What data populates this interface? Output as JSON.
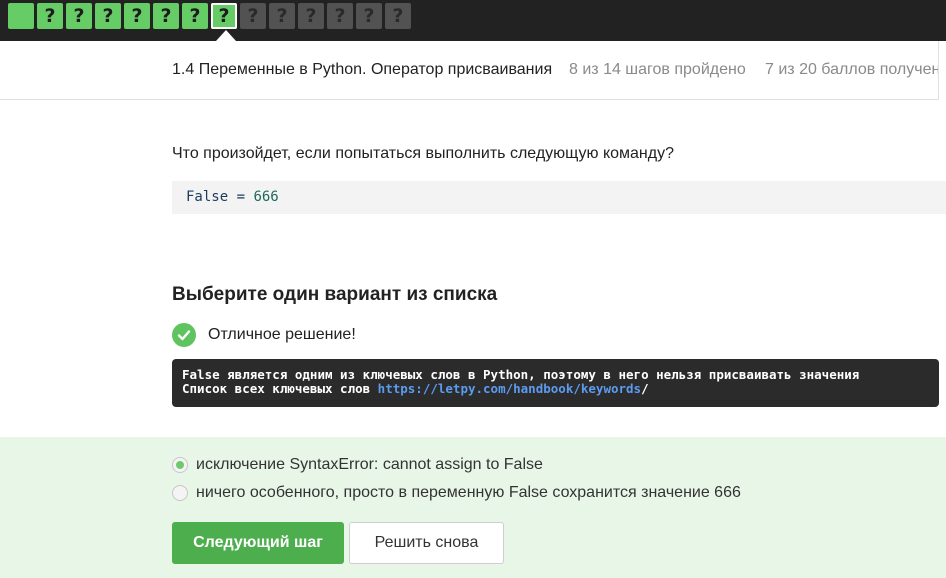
{
  "steps": [
    {
      "state": "done",
      "label": ""
    },
    {
      "state": "done",
      "label": "?"
    },
    {
      "state": "done",
      "label": "?"
    },
    {
      "state": "done",
      "label": "?"
    },
    {
      "state": "done",
      "label": "?"
    },
    {
      "state": "done",
      "label": "?"
    },
    {
      "state": "done",
      "label": "?"
    },
    {
      "state": "active",
      "label": "?"
    },
    {
      "state": "pending",
      "label": "?"
    },
    {
      "state": "pending",
      "label": "?"
    },
    {
      "state": "pending",
      "label": "?"
    },
    {
      "state": "pending",
      "label": "?"
    },
    {
      "state": "pending",
      "label": "?"
    },
    {
      "state": "pending",
      "label": "?"
    }
  ],
  "lesson": {
    "title": "1.4 Переменные в Python. Оператор присваивания",
    "steps_progress": "8 из 14 шагов пройдено",
    "score": "7 из 20 баллов  получен"
  },
  "question": {
    "text": "Что произойдет, если попытаться выполнить следующую команду?",
    "code_keyword": "False",
    "code_op": " = ",
    "code_value": "666"
  },
  "choice": {
    "title": "Выберите один вариант из списка",
    "result_text": "Отличное решение!",
    "feedback_line1": "False является одним из ключевых слов в Python, поэтому в него нельзя присваивать значения",
    "feedback_line2_prefix": "Список всех ключевых слов ",
    "feedback_link": "https://letpy.com/handbook/keywords",
    "feedback_suffix": "/"
  },
  "options": [
    {
      "label": "исключение SyntaxError: cannot assign to False",
      "selected": true
    },
    {
      "label": "ничего особенного, просто в переменную False сохранится значение 666",
      "selected": false
    }
  ],
  "buttons": {
    "next": "Следующий шаг",
    "retry": "Решить снова"
  },
  "colors": {
    "accent_green": "#4cae4c",
    "step_done": "#66cc66",
    "answer_bg": "#e8f6e8"
  }
}
